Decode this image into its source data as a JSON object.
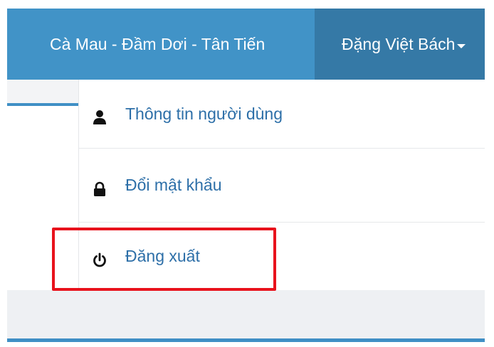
{
  "header": {
    "location": "Cà Mau - Đầm Dơi - Tân Tiến",
    "user_name": "Đặng Việt Bách"
  },
  "user_menu": {
    "items": [
      {
        "label": "Thông tin người dùng",
        "icon": "user-icon"
      },
      {
        "label": "Đổi mật khẩu",
        "icon": "lock-icon"
      },
      {
        "label": "Đăng xuất",
        "icon": "power-icon"
      }
    ]
  },
  "colors": {
    "header_bg": "#4193c7",
    "user_toggle_bg": "#3579a6",
    "menu_text": "#2d6fa8",
    "highlight_border": "#e8121c"
  }
}
